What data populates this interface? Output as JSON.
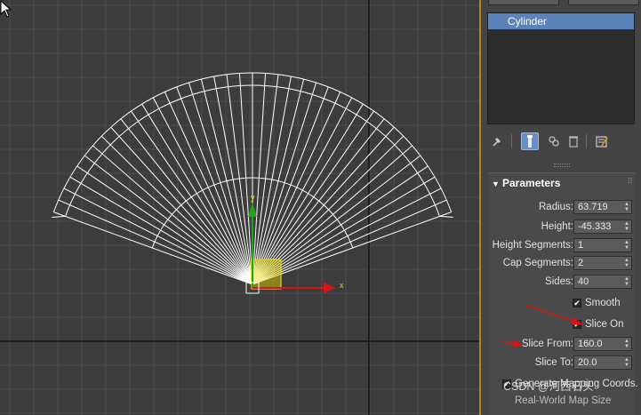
{
  "viewport": {
    "axis_x_label": "x",
    "axis_y_label": "y"
  },
  "object_list": {
    "selected_item": "Cylinder"
  },
  "modifier_stack_icons": [
    "pin-stack-icon",
    "show-end-result-icon",
    "make-unique-icon",
    "remove-modifier-icon",
    "configure-modifier-sets-icon"
  ],
  "parameters": {
    "title": "Parameters",
    "radius_label": "Radius:",
    "radius_value": "63.719",
    "height_label": "Height:",
    "height_value": "-45.333",
    "height_segments_label": "Height Segments:",
    "height_segments_value": "1",
    "cap_segments_label": "Cap Segments:",
    "cap_segments_value": "2",
    "sides_label": "Sides:",
    "sides_value": "40",
    "smooth_label": "Smooth",
    "smooth_checked": true,
    "slice_on_label": "Slice On",
    "slice_on_checked": true,
    "slice_from_label": "Slice From:",
    "slice_from_value": "160.0",
    "slice_to_label": "Slice To:",
    "slice_to_value": "20.0",
    "generate_mapping_label": "Generate Mapping Coords.",
    "generate_mapping_checked": true,
    "real_world_label": "Real-World Map Size"
  },
  "watermark": "CSDN @河西石头",
  "colors": {
    "selection": "#5c82ba",
    "annotation_arrow": "#e01010",
    "gizmo_yellow": "#e8d800",
    "gizmo_green": "#1aa81a",
    "gizmo_red": "#d81414",
    "wire": "#ffffff"
  }
}
